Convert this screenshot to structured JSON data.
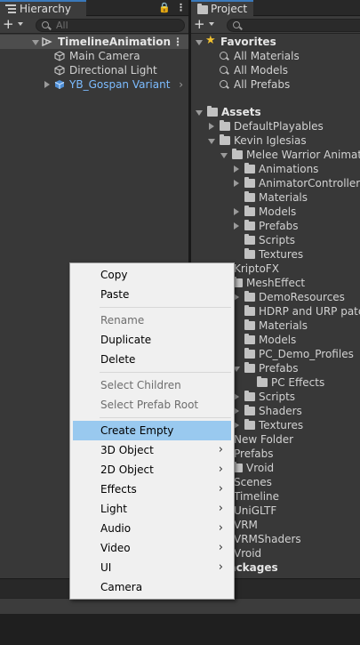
{
  "hierarchy": {
    "tab_title": "Hierarchy",
    "search_placeholder": "All",
    "scene": "TimelineAnimation",
    "items": [
      {
        "label": "Main Camera"
      },
      {
        "label": "Directional Light"
      },
      {
        "label": "YB_Gospan Variant"
      }
    ]
  },
  "project": {
    "tab_title": "Project",
    "favorites": {
      "label": "Favorites",
      "items": [
        "All Materials",
        "All Models",
        "All Prefabs"
      ]
    },
    "assets": {
      "label": "Assets",
      "items": [
        "DefaultPlayables",
        "Kevin Iglesias",
        "Melee Warrior Animations",
        "Animations",
        "AnimatorControllers",
        "Materials",
        "Models",
        "Prefabs",
        "Scripts",
        "Textures",
        "KriptoFX",
        "MeshEffect",
        "DemoResources",
        "HDRP and URP patch",
        "Materials",
        "Models",
        "PC_Demo_Profiles",
        "Prefabs",
        "PC Effects",
        "Scripts",
        "Shaders",
        "Textures",
        "New Folder",
        "Prefabs",
        "Vroid",
        "Scenes",
        "Timeline",
        "UniGLTF",
        "VRM",
        "VRMShaders",
        "Vroid",
        "Packages"
      ]
    }
  },
  "context_menu": {
    "items": [
      {
        "label": "Copy",
        "enabled": true
      },
      {
        "label": "Paste",
        "enabled": true
      },
      {
        "label": "Rename",
        "enabled": false
      },
      {
        "label": "Duplicate",
        "enabled": true
      },
      {
        "label": "Delete",
        "enabled": true
      },
      {
        "label": "Select Children",
        "enabled": false
      },
      {
        "label": "Select Prefab Root",
        "enabled": false
      },
      {
        "label": "Create Empty",
        "enabled": true,
        "highlighted": true
      },
      {
        "label": "3D Object",
        "enabled": true,
        "submenu": true
      },
      {
        "label": "2D Object",
        "enabled": true,
        "submenu": true
      },
      {
        "label": "Effects",
        "enabled": true,
        "submenu": true
      },
      {
        "label": "Light",
        "enabled": true,
        "submenu": true
      },
      {
        "label": "Audio",
        "enabled": true,
        "submenu": true
      },
      {
        "label": "Video",
        "enabled": true,
        "submenu": true
      },
      {
        "label": "UI",
        "enabled": true,
        "submenu": true
      },
      {
        "label": "Camera",
        "enabled": true
      }
    ]
  },
  "colors": {
    "accent": "#3a79bb",
    "highlight": "#99c9ef",
    "prefab_blue": "#7dbcff",
    "favorite_star": "#f2c230"
  }
}
